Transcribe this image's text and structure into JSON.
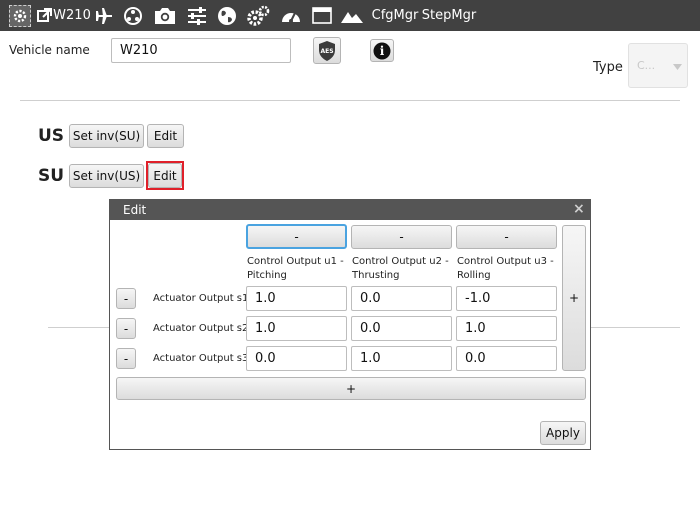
{
  "toolbar": {
    "vehicle_tag": "W210",
    "icons": [
      "gear-icon",
      "external-link-icon",
      "plane-icon",
      "network-icon",
      "camera-icon",
      "sliders-icon",
      "globe-icon",
      "cogs-icon",
      "gauge-icon",
      "window-icon",
      "mountain-icon"
    ],
    "cfgmgr": "CfgMgr",
    "stepmgr": "StepMgr"
  },
  "vehicle": {
    "name_label": "Vehicle name",
    "name_value": "W210",
    "aes_label": "AES",
    "info_label": "i",
    "type_label": "Type",
    "type_value": "C..."
  },
  "us": {
    "label": "US",
    "set_inv": "Set inv(SU)",
    "edit": "Edit"
  },
  "su": {
    "label": "SU",
    "set_inv": "Set inv(US)",
    "edit": "Edit"
  },
  "dialog": {
    "title": "Edit",
    "close": "×",
    "col_buttons": [
      "-",
      "-",
      "-"
    ],
    "col_headers": [
      [
        "Control Output u1 -",
        "Pitching"
      ],
      [
        "Control Output u2 -",
        "Thrusting"
      ],
      [
        "Control Output u3 -",
        "Rolling"
      ]
    ],
    "add_col": "+",
    "rows": [
      {
        "remove": "-",
        "label": "Actuator Output s1",
        "values": [
          "1.0",
          "0.0",
          "-1.0"
        ]
      },
      {
        "remove": "-",
        "label": "Actuator Output s2",
        "values": [
          "1.0",
          "0.0",
          "1.0"
        ]
      },
      {
        "remove": "-",
        "label": "Actuator Output s3",
        "values": [
          "0.0",
          "1.0",
          "0.0"
        ]
      }
    ],
    "add_row": "+",
    "apply": "Apply"
  }
}
